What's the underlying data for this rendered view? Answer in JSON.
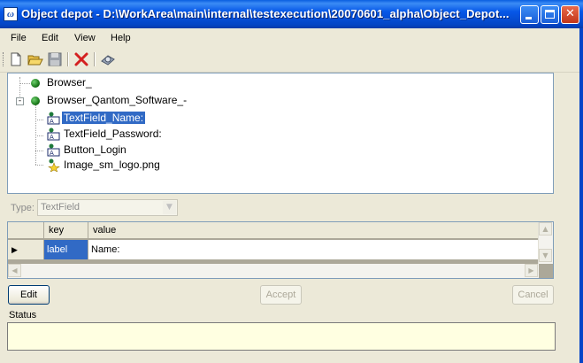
{
  "window": {
    "title": "Object depot - D:\\WorkArea\\main\\internal\\testexecution\\20070601_alpha\\Object_Depot...",
    "app_icon": "app-logo-icon",
    "controls": [
      "minimize-icon",
      "maximize-icon",
      "close-icon"
    ]
  },
  "menu": {
    "file": "File",
    "edit": "Edit",
    "view": "View",
    "help": "Help"
  },
  "toolbar": [
    "new-document-icon",
    "open-folder-icon",
    "save-icon",
    "delete-icon",
    "settings-icon"
  ],
  "tree": {
    "nodes": [
      {
        "label": "Browser_",
        "icon": "globe-icon"
      },
      {
        "label": "Browser_Qantom_Software_-",
        "icon": "globe-icon",
        "expanded": true,
        "children": [
          {
            "label": "TextField_Name:",
            "icon": "textfield-icon",
            "selected": true
          },
          {
            "label": "TextField_Password:",
            "icon": "textfield-icon"
          },
          {
            "label": "Button_Login",
            "icon": "textfield-icon"
          },
          {
            "label": "Image_sm_logo.png",
            "icon": "image-star-icon"
          }
        ]
      }
    ]
  },
  "type_field": {
    "label": "Type:",
    "value": "TextField"
  },
  "grid": {
    "columns": [
      "key",
      "value"
    ],
    "rows": [
      {
        "key": "label",
        "value": "Name:"
      }
    ]
  },
  "buttons": {
    "edit": "Edit",
    "accept": "Accept",
    "cancel": "Cancel"
  },
  "status": {
    "label": "Status",
    "text": ""
  },
  "colors": {
    "titlebar": "#0a5fe0",
    "selection": "#316ac5",
    "status_bg": "#ffffe1"
  }
}
